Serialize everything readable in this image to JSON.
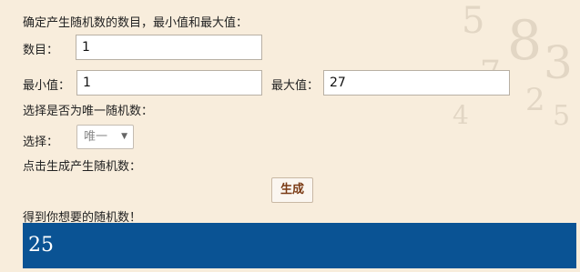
{
  "prompt_count": "确定产生随机数的数目，最小值和最大值：",
  "count": {
    "label": "数目：",
    "value": "1"
  },
  "min": {
    "label": "最小值：",
    "value": "1"
  },
  "max": {
    "label": "最大值：",
    "value": "27"
  },
  "unique_prompt": "选择是否为唯一随机数：",
  "choice": {
    "label": "选择：",
    "selected": "唯一"
  },
  "generate_prompt": "点击生成产生随机数：",
  "generate_button": "生成",
  "result_prompt": "得到你想要的随机数！",
  "result_value": "25",
  "colors": {
    "background": "#f8eddc",
    "result_bg": "#0a5394",
    "button_text": "#7a3a14"
  }
}
